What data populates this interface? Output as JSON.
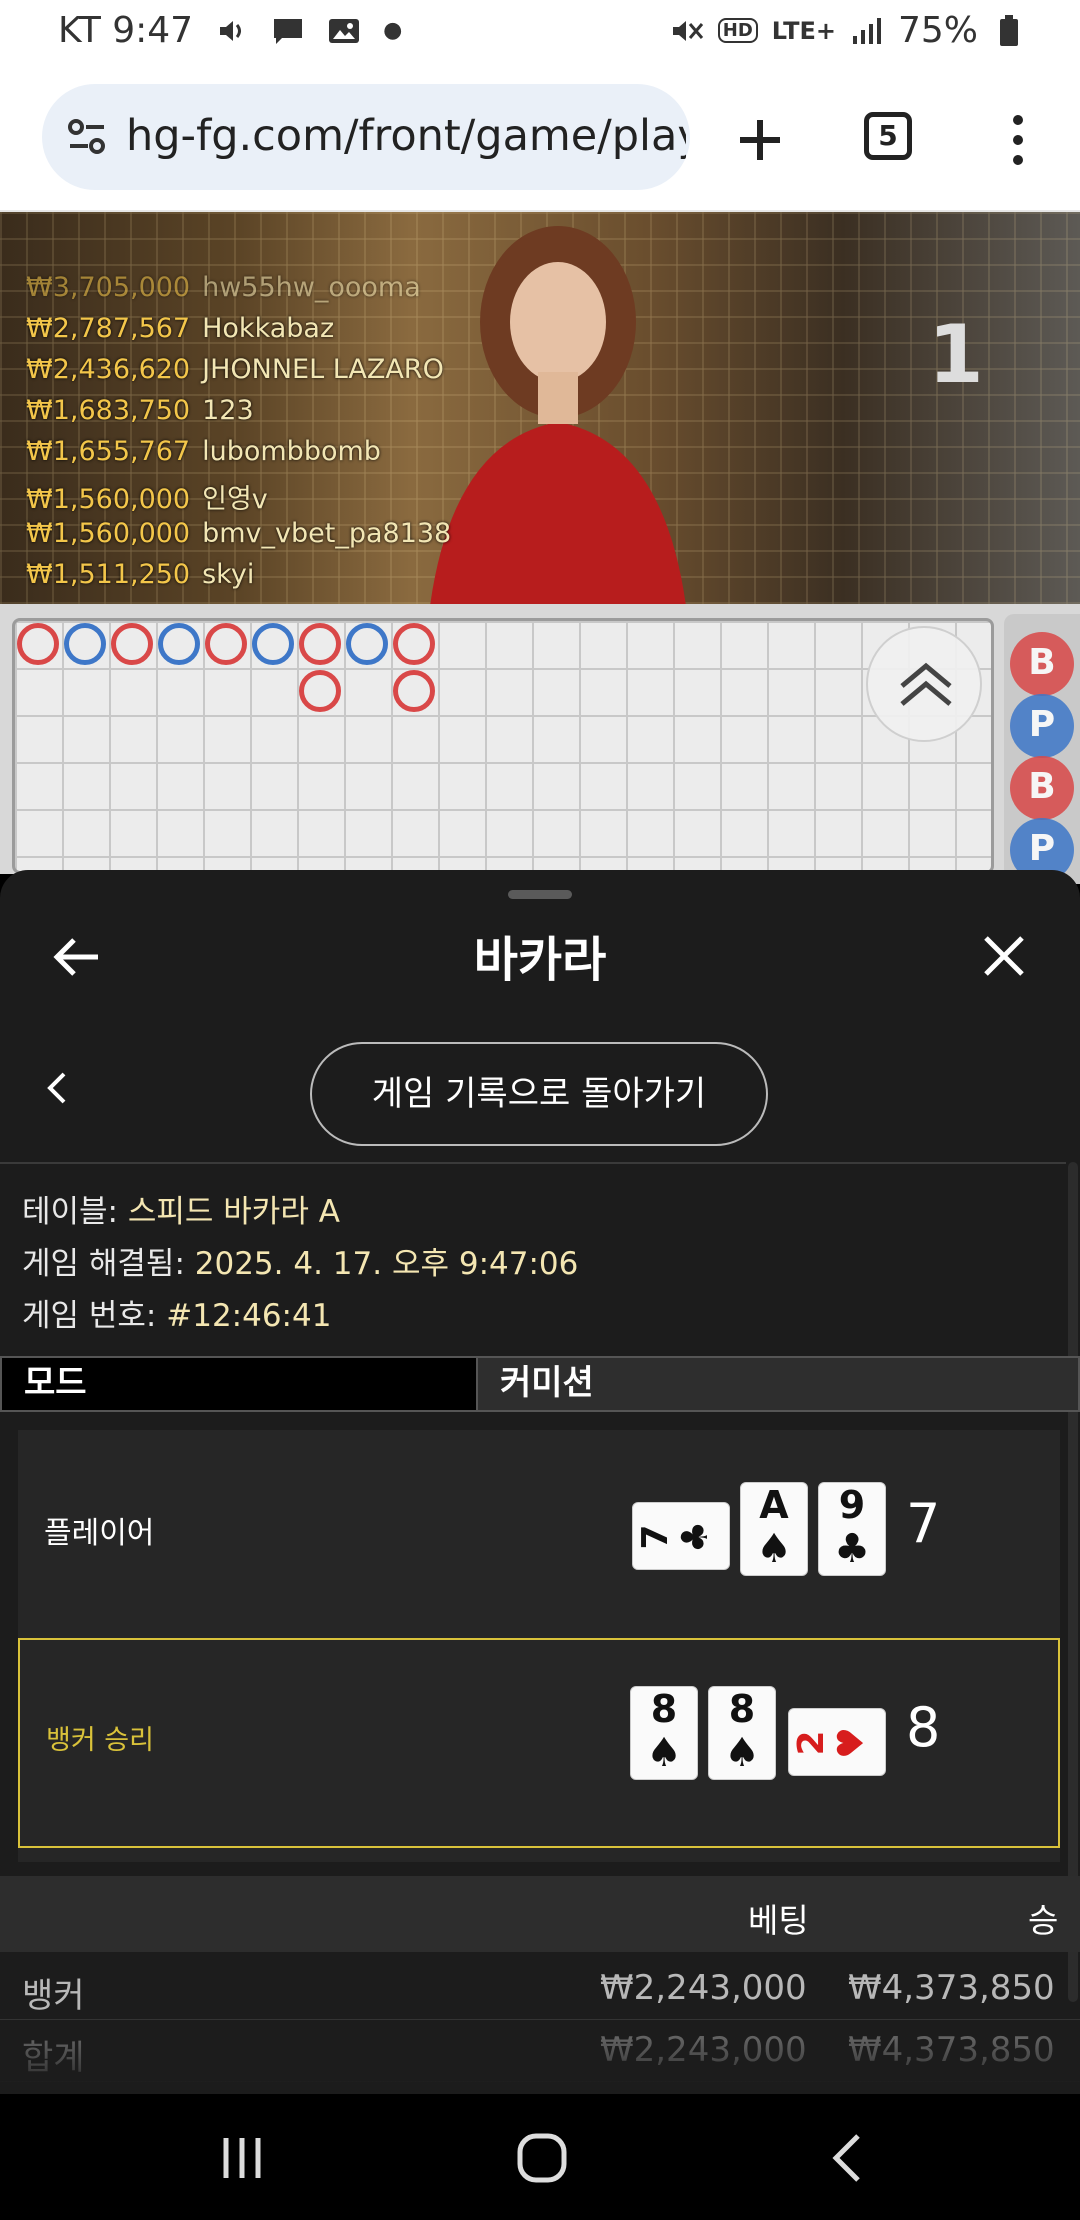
{
  "status_bar": {
    "carrier_time": "KT 9:47",
    "network": "LTE+",
    "battery": "75%",
    "hd": "HD"
  },
  "browser": {
    "url": "hg-fg.com/front/game/play",
    "tab_count": "5"
  },
  "video": {
    "leaderboard": [
      {
        "amount": "₩3,705,000",
        "name": "hw55hw_oooma"
      },
      {
        "amount": "₩2,787,567",
        "name": "Hokkabaz"
      },
      {
        "amount": "₩2,436,620",
        "name": "JHONNEL LAZARO"
      },
      {
        "amount": "₩1,683,750",
        "name": "123"
      },
      {
        "amount": "₩1,655,767",
        "name": "lubombbomb"
      },
      {
        "amount": "₩1,560,000",
        "name": "인영v"
      },
      {
        "amount": "₩1,560,000",
        "name": "bmv_vbet_pa8138"
      },
      {
        "amount": "₩1,511,250",
        "name": "skyi"
      }
    ],
    "round_number": "1"
  },
  "roadmap": {
    "beads": [
      {
        "col": 0,
        "row": 0,
        "side": "B"
      },
      {
        "col": 1,
        "row": 0,
        "side": "P"
      },
      {
        "col": 2,
        "row": 0,
        "side": "B"
      },
      {
        "col": 3,
        "row": 0,
        "side": "P"
      },
      {
        "col": 4,
        "row": 0,
        "side": "B"
      },
      {
        "col": 5,
        "row": 0,
        "side": "P"
      },
      {
        "col": 6,
        "row": 0,
        "side": "B"
      },
      {
        "col": 6,
        "row": 1,
        "side": "B"
      },
      {
        "col": 7,
        "row": 0,
        "side": "P"
      },
      {
        "col": 8,
        "row": 0,
        "side": "B"
      },
      {
        "col": 8,
        "row": 1,
        "side": "B"
      }
    ],
    "side_labels": [
      "B",
      "P",
      "B",
      "P"
    ],
    "colors": {
      "banker": "#d94848",
      "player": "#3e77c8"
    }
  },
  "sheet": {
    "title": "바카라",
    "back_to_history": "게임 기록으로 돌아가기",
    "info": {
      "table_label": "테이블:",
      "table_value": "스피드 바카라 A",
      "resolved_label": "게임 해결됨:",
      "resolved_value": "2025. 4. 17. 오후 9:47:06",
      "number_label": "게임 번호:",
      "number_value": "#12:46:41"
    },
    "tabs": {
      "mode": "모드",
      "commission": "커미션"
    },
    "player": {
      "label": "플레이어",
      "cards": [
        {
          "rank": "7",
          "suit": "♣",
          "rotated": true
        },
        {
          "rank": "A",
          "suit": "♠",
          "rotated": false
        },
        {
          "rank": "9",
          "suit": "♣",
          "rotated": false
        }
      ],
      "total": "7"
    },
    "banker": {
      "label": "뱅커 승리",
      "cards": [
        {
          "rank": "8",
          "suit": "♠",
          "rotated": false
        },
        {
          "rank": "8",
          "suit": "♠",
          "rotated": false
        },
        {
          "rank": "2",
          "suit": "♥",
          "rotated": true
        }
      ],
      "total": "8"
    },
    "bets": {
      "header_bet": "베팅",
      "header_win": "승",
      "rows": [
        {
          "name": "뱅커",
          "bet": "₩2,243,000",
          "win": "₩4,373,850"
        },
        {
          "name": "합계",
          "bet": "₩2,243,000",
          "win": "₩4,373,850"
        }
      ]
    },
    "accent_color": "#d9c23a"
  }
}
